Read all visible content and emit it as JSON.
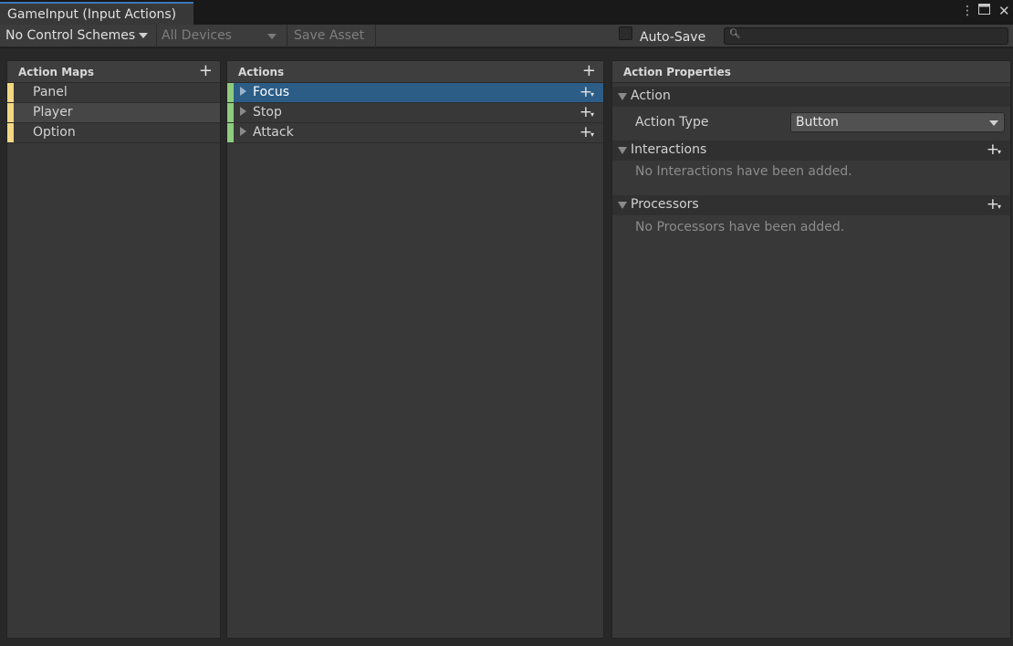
{
  "window": {
    "tab_title": "GameInput (Input Actions)",
    "menu_icon": "kebab-menu-icon",
    "maximize_icon": "maximize-icon",
    "close_icon": "close-icon"
  },
  "toolbar": {
    "control_schemes": "No Control Schemes",
    "devices": "All Devices",
    "save_asset": "Save Asset",
    "auto_save_label": "Auto-Save",
    "auto_save_checked": false,
    "search_value": "",
    "search_icon": "search-icon"
  },
  "action_maps": {
    "header": "Action Maps",
    "items": [
      {
        "label": "Panel",
        "selected": false
      },
      {
        "label": "Player",
        "selected": true
      },
      {
        "label": "Option",
        "selected": false
      }
    ]
  },
  "actions": {
    "header": "Actions",
    "items": [
      {
        "label": "Focus",
        "selected": true
      },
      {
        "label": "Stop",
        "selected": false
      },
      {
        "label": "Attack",
        "selected": false
      }
    ]
  },
  "properties": {
    "header": "Action Properties",
    "action_section": "Action",
    "action_type_label": "Action Type",
    "action_type_value": "Button",
    "interactions_section": "Interactions",
    "interactions_empty": "No Interactions have been added.",
    "processors_section": "Processors",
    "processors_empty": "No Processors have been added."
  },
  "colors": {
    "accent_tab": "#3a79bb",
    "selection": "#2c5d87",
    "map_stripe": "#f2d884",
    "action_stripe": "#8fcb7e"
  }
}
